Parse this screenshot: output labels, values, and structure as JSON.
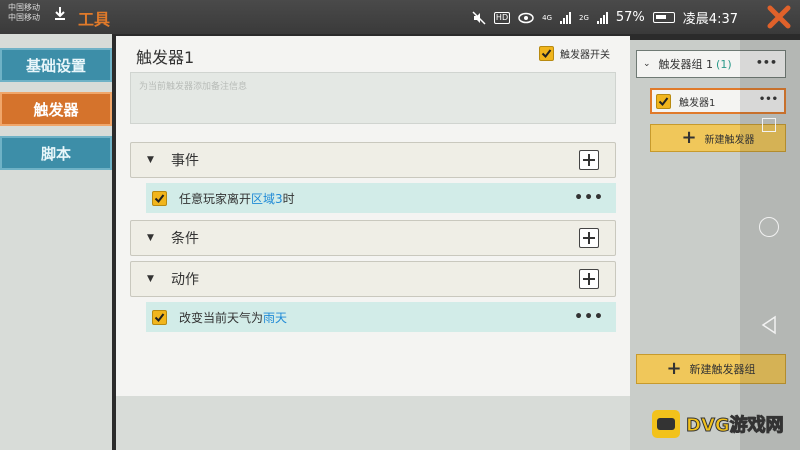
{
  "status_bar": {
    "carrier_1": "中国移动",
    "carrier_2": "中国移动",
    "app_title": "工具",
    "battery": "57%",
    "time": "凌晨4:37",
    "network_1": "4G",
    "network_2": "2G",
    "hd_badge": "HD"
  },
  "left_nav": {
    "tabs": [
      {
        "label": "基础设置"
      },
      {
        "label": "触发器"
      },
      {
        "label": "脚本"
      }
    ]
  },
  "main": {
    "title": "触发器1",
    "enable_switch_label": "触发器开关",
    "note_placeholder": "为当前触发器添加备注信息",
    "sections": [
      {
        "label": "事件"
      },
      {
        "label": "条件"
      },
      {
        "label": "动作"
      }
    ],
    "event_item": {
      "prefix": "任意玩家离开",
      "highlight": "区域3",
      "suffix": "时"
    },
    "action_item": {
      "prefix": "改变当前天气为",
      "highlight": "雨天"
    },
    "more": "•••"
  },
  "right_panel": {
    "group_label": "触发器组 1",
    "group_count": "(1)",
    "trigger_label": "触发器1",
    "new_trigger_label": "新建触发器",
    "new_group_label": "新建触发器组",
    "more": "•••"
  },
  "watermark": {
    "text": "DVG游戏网"
  },
  "colors": {
    "accent_orange": "#e07a2a",
    "tab_blue": "#3d8ea8",
    "checkbox_yellow": "#f1b51c",
    "link_blue": "#1f8ad6",
    "item_bg": "#d2ece8"
  }
}
